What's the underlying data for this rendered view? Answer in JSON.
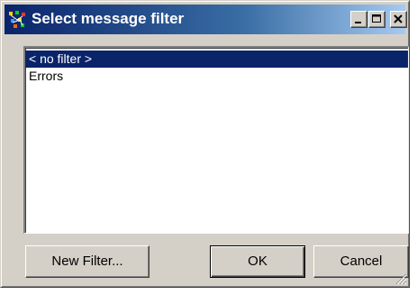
{
  "window": {
    "title": "Select message filter",
    "title_icon": "app-icon",
    "controls": {
      "minimize_icon": "minimize-icon",
      "maximize_icon": "maximize-icon",
      "close_icon": "close-icon"
    }
  },
  "filter_list": {
    "items": [
      {
        "label": "< no filter >",
        "selected": true
      },
      {
        "label": "Errors",
        "selected": false
      }
    ]
  },
  "buttons": {
    "new_filter": "New Filter...",
    "ok": "OK",
    "cancel": "Cancel"
  },
  "colors": {
    "titlebar": "#0a246a",
    "selection": "#0a246a",
    "face": "#d4d0c8"
  }
}
